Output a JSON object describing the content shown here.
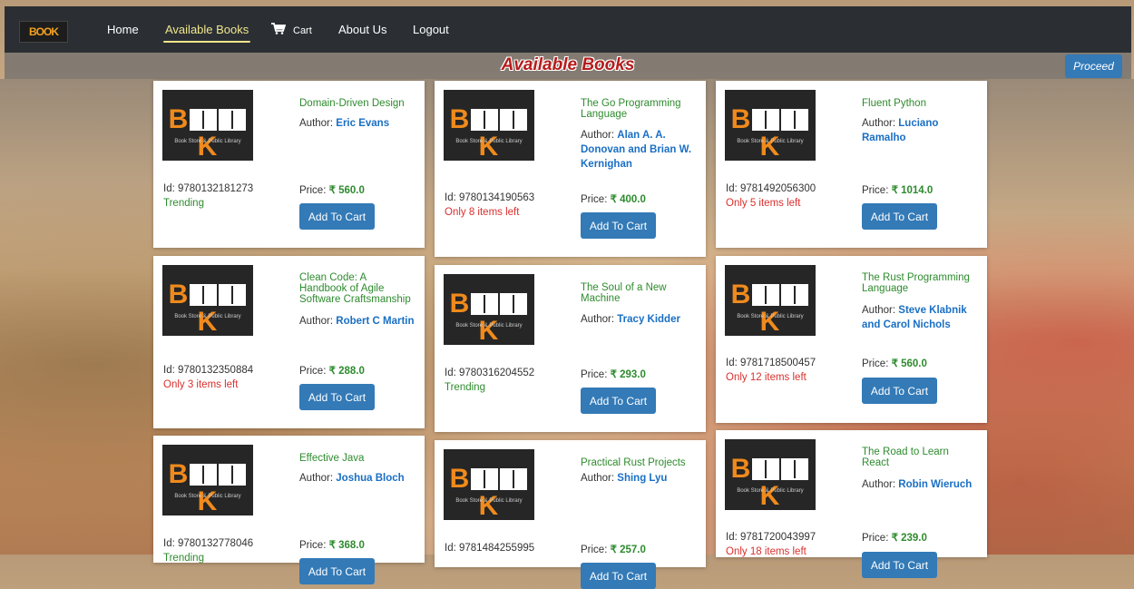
{
  "nav": {
    "logo": "BOOK",
    "home": "Home",
    "available_books": "Available Books",
    "cart": "Cart",
    "about": "About Us",
    "logout": "Logout"
  },
  "header": {
    "title": "Available Books",
    "proceed": "Proceed"
  },
  "cover": {
    "left": "B",
    "right": "K",
    "sub": "Book Store & Public Library"
  },
  "labels": {
    "author": "Author:",
    "id": "Id:",
    "price": "Price:",
    "add_to_cart": "Add To Cart"
  },
  "books": [
    {
      "title": "Domain-Driven Design",
      "author": "Eric Evans",
      "id": "9780132181273",
      "price": "₹ 560.0",
      "stock": "Trending"
    },
    {
      "title": "The Go Programming Language",
      "author": "Alan A. A. Donovan and Brian W. Kernighan",
      "id": "9780134190563",
      "price": "₹ 400.0",
      "stock": "Only 8 items left"
    },
    {
      "title": "Fluent Python",
      "author": "Luciano Ramalho",
      "id": "9781492056300",
      "price": "₹ 1014.0",
      "stock": "Only 5 items left"
    },
    {
      "title": "Clean Code: A Handbook of Agile Software Craftsmanship",
      "author": "Robert C Martin",
      "id": "9780132350884",
      "price": "₹ 288.0",
      "stock": "Only 3 items left"
    },
    {
      "title": "The Soul of a New Machine",
      "author": "Tracy Kidder",
      "id": "9780316204552",
      "price": "₹ 293.0",
      "stock": "Trending"
    },
    {
      "title": "The Rust Programming Language",
      "author": "Steve Klabnik and Carol Nichols",
      "id": "9781718500457",
      "price": "₹ 560.0",
      "stock": "Only 12 items left"
    },
    {
      "title": "Effective Java",
      "author": "Joshua Bloch",
      "id": "9780132778046",
      "price": "₹ 368.0",
      "stock": "Trending"
    },
    {
      "title": "Practical Rust Projects",
      "author": "Shing Lyu",
      "id": "9781484255995",
      "price": "₹ 257.0",
      "stock": ""
    },
    {
      "title": "The Road to Learn React",
      "author": "Robin Wieruch",
      "id": "9781720043997",
      "price": "₹ 239.0",
      "stock": "Only 18 items left"
    }
  ],
  "colors": {
    "navbar": "#2b2f34",
    "accent": "#337ab7",
    "title_green": "#2e8b2e",
    "author_blue": "#1a6fc4",
    "low_stock_red": "#d9302e",
    "active_nav": "#f0e68c"
  }
}
